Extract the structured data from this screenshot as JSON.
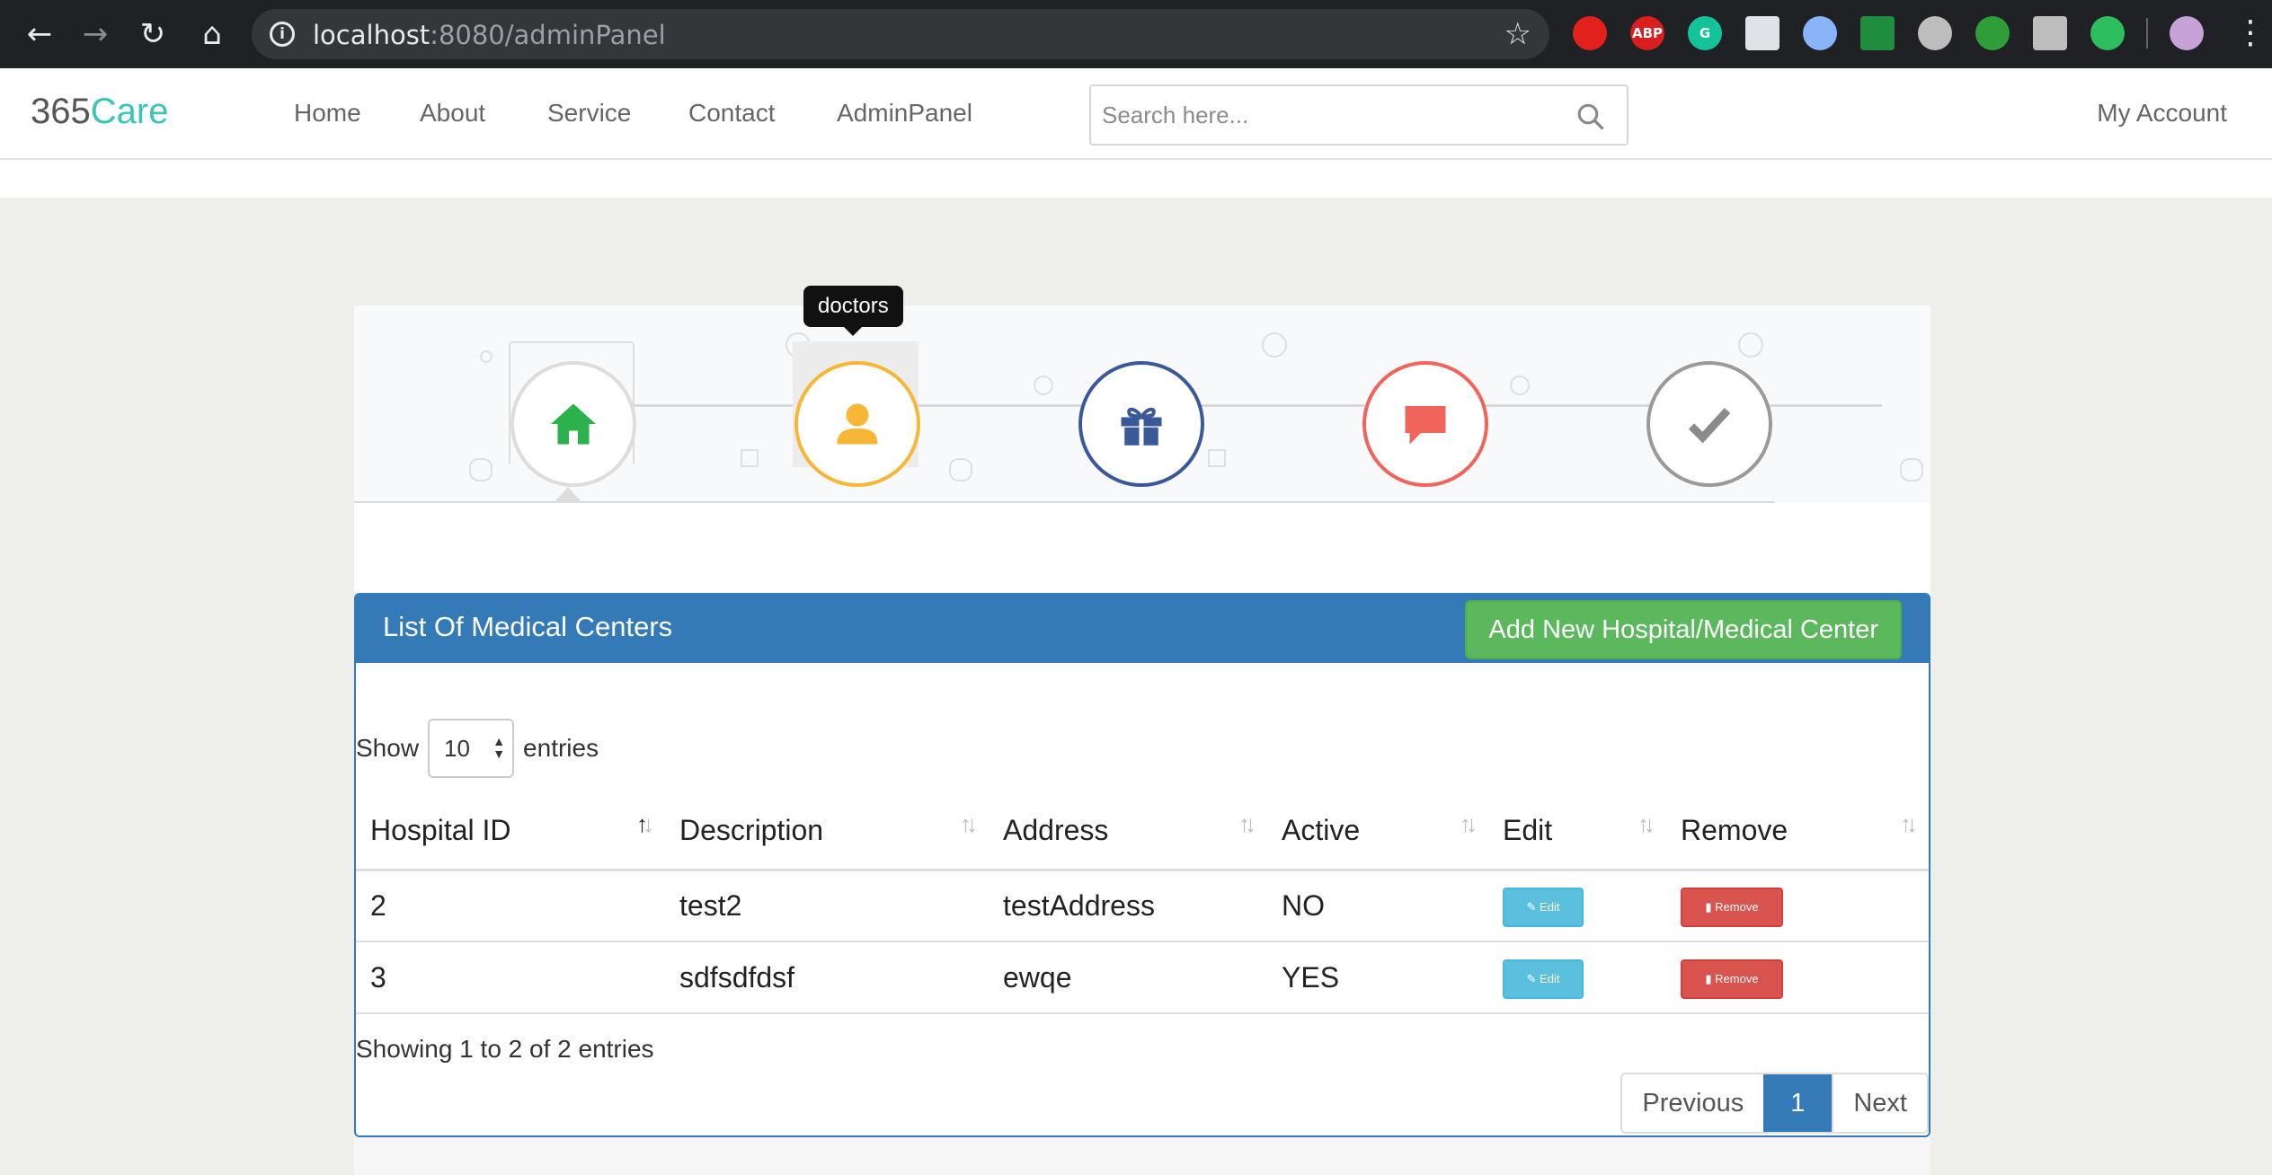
{
  "browser": {
    "url_host": "localhost",
    "url_path": ":8080/adminPanel",
    "icons": [
      "back-icon",
      "forward-icon",
      "reload-icon",
      "home-icon",
      "info-icon",
      "star-icon",
      "menu-icon"
    ],
    "extensions": [
      {
        "name": "stop-extension-icon",
        "label": "",
        "color": "#e2201c"
      },
      {
        "name": "adblock-extension-icon",
        "label": "ABP",
        "color": "#d81e1e"
      },
      {
        "name": "grammarly-extension-icon",
        "label": "G",
        "color": "#15c39a"
      },
      {
        "name": "document-extension-icon",
        "label": "",
        "color": "#dfe3e8"
      },
      {
        "name": "ring-extension-icon",
        "label": "",
        "color": "#8ab4f8"
      },
      {
        "name": "screenshot-extension-icon",
        "label": "",
        "color": "#1e8e3e"
      },
      {
        "name": "cookie-extension-icon",
        "label": "",
        "color": "#bdbdbd"
      },
      {
        "name": "bug-extension-icon",
        "label": "",
        "color": "#2e9d3a"
      },
      {
        "name": "terminal-extension-icon",
        "label": "",
        "color": "#bdbdbd"
      },
      {
        "name": "evernote-extension-icon",
        "label": "",
        "color": "#2dbe60"
      }
    ]
  },
  "site": {
    "logo_num": "365",
    "logo_word": "Care",
    "nav": [
      "Home",
      "About",
      "Service",
      "Contact",
      "AdminPanel"
    ],
    "search_placeholder": "Search here...",
    "account": "My Account"
  },
  "wizard": {
    "tooltip": "doctors",
    "steps": [
      {
        "name": "step-home",
        "icon": "home-icon",
        "color": "#2bb24c",
        "border": "#dddddd"
      },
      {
        "name": "step-doctors",
        "icon": "user-icon",
        "color": "#f5b735",
        "border": "#f5b735"
      },
      {
        "name": "step-gift",
        "icon": "gift-icon",
        "color": "#3b5998",
        "border": "#3b5998"
      },
      {
        "name": "step-message",
        "icon": "chat-icon",
        "color": "#f0645c",
        "border": "#f0645c"
      },
      {
        "name": "step-done",
        "icon": "check-icon",
        "color": "#8a8a8a",
        "border": "#9a9a9a"
      }
    ]
  },
  "panel": {
    "title": "List Of Medical Centers",
    "add_button": "Add New Hospital/Medical Center",
    "show_label": "Show",
    "entries_label": "entries",
    "page_length": "10",
    "columns": [
      "Hospital ID",
      "Description",
      "Address",
      "Active",
      "Edit",
      "Remove"
    ],
    "rows": [
      {
        "id": "2",
        "description": "test2",
        "address": "testAddress",
        "active": "NO",
        "edit": "Edit",
        "remove": "Remove"
      },
      {
        "id": "3",
        "description": "sdfsdfdsf",
        "address": "ewqe",
        "active": "YES",
        "edit": "Edit",
        "remove": "Remove"
      }
    ],
    "info": "Showing 1 to 2 of 2 entries",
    "pagination": {
      "previous": "Previous",
      "current": "1",
      "next": "Next"
    }
  }
}
